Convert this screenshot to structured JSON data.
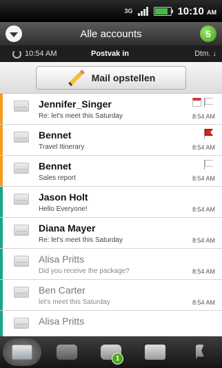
{
  "status_bar": {
    "time": "10:10",
    "time_suffix": "AM",
    "network": "3G",
    "battery_level": 0.8,
    "battery_color": "#3fbf3f"
  },
  "header": {
    "title": "Alle accounts",
    "unread_count": "5"
  },
  "subheader": {
    "last_sync": "10:54 AM",
    "folder": "Postvak in",
    "sort_label": "Dtm."
  },
  "compose": {
    "label": "Mail opstellen"
  },
  "emails": [
    {
      "sender": "Jennifer_Singer",
      "subject": "Re: let's meet this Saturday",
      "time": "8:54 AM",
      "unread": true,
      "accent": "#f39c1f",
      "flag": "white",
      "calendar": true
    },
    {
      "sender": "Bennet",
      "subject": "Travel Itinerary",
      "time": "8:54 AM",
      "unread": true,
      "accent": "#f39c1f",
      "flag": "red",
      "calendar": false
    },
    {
      "sender": "Bennet",
      "subject": "Sales report",
      "time": "8:54 AM",
      "unread": true,
      "accent": "#f39c1f",
      "flag": "white",
      "calendar": false
    },
    {
      "sender": "Jason Holt",
      "subject": "Hello Everyone!",
      "time": "8:54 AM",
      "unread": true,
      "accent": "#1aa58c",
      "flag": null,
      "calendar": false
    },
    {
      "sender": "Diana Mayer",
      "subject": "Re: let's meet this Saturday",
      "time": "8:54 AM",
      "unread": true,
      "accent": "#1aa58c",
      "flag": null,
      "calendar": false
    },
    {
      "sender": "Alisa Pritts",
      "subject": "Did you receive the package?",
      "time": "8:54 AM",
      "unread": false,
      "accent": "#1aa58c",
      "flag": null,
      "calendar": false
    },
    {
      "sender": "Ben Carter",
      "subject": "let's meet this Saturday",
      "time": "8:54 AM",
      "unread": false,
      "accent": "#1aa58c",
      "flag": null,
      "calendar": false
    },
    {
      "sender": "Alisa Pritts",
      "subject": "",
      "time": "",
      "unread": false,
      "accent": "#1aa58c",
      "flag": null,
      "calendar": false
    }
  ],
  "tabs": [
    {
      "icon": "inbox-icon",
      "active": true
    },
    {
      "icon": "conversations-icon",
      "active": false
    },
    {
      "icon": "unread-icon",
      "active": false,
      "badge": "1"
    },
    {
      "icon": "mail-icon",
      "active": false
    },
    {
      "icon": "flagged-icon",
      "active": false
    }
  ]
}
